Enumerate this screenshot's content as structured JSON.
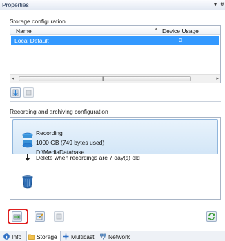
{
  "window": {
    "title": "Properties",
    "pin_glyph": "▾",
    "close_glyph": "ᵾ"
  },
  "storage": {
    "section_label": "Storage configuration",
    "columns": {
      "name": "Name",
      "usage": "Device Usage"
    },
    "rows": [
      {
        "name": "Local Default",
        "usage": "0"
      }
    ]
  },
  "recording": {
    "section_label": "Recording and archiving configuration",
    "title": "Recording",
    "size": "1000 GB (749 bytes used)",
    "path": "D:\\MediaDatabase",
    "delete_note": "Delete when recordings are 7 day(s) old"
  },
  "tabs": [
    {
      "label": "Info",
      "icon": "info-icon"
    },
    {
      "label": "Storage",
      "icon": "storage-folder-icon",
      "active": true
    },
    {
      "label": "Multicast",
      "icon": "multicast-icon"
    },
    {
      "label": "Network",
      "icon": "network-icon"
    }
  ],
  "colors": {
    "selection": "#3399ff",
    "highlight_ring": "#e02020",
    "accent_blue": "#1f6fc5",
    "green": "#3a9b3a"
  }
}
